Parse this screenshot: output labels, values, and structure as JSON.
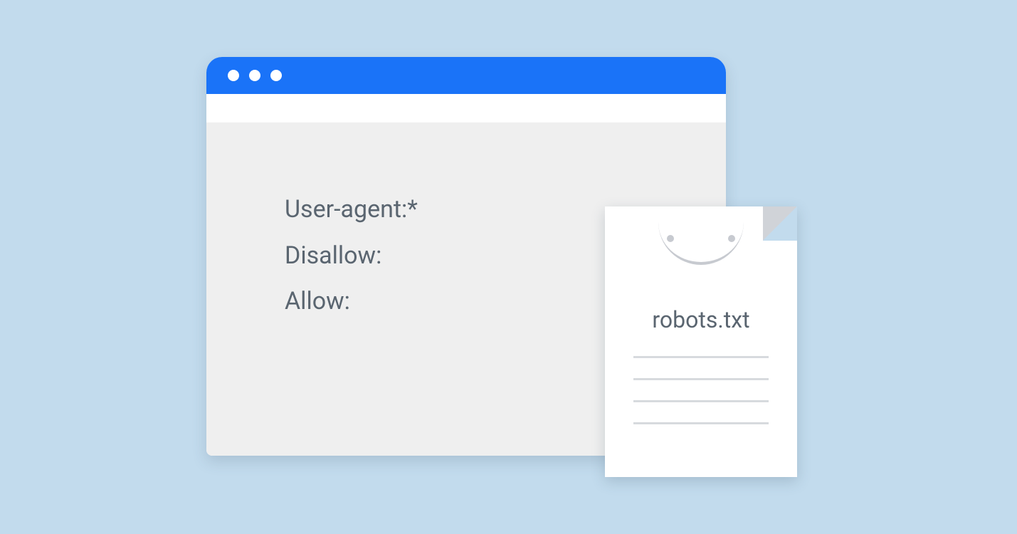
{
  "browser": {
    "lines": {
      "l1": "User-agent:*",
      "l2": "Disallow:",
      "l3": "Allow:"
    }
  },
  "file": {
    "label": "robots.txt"
  }
}
